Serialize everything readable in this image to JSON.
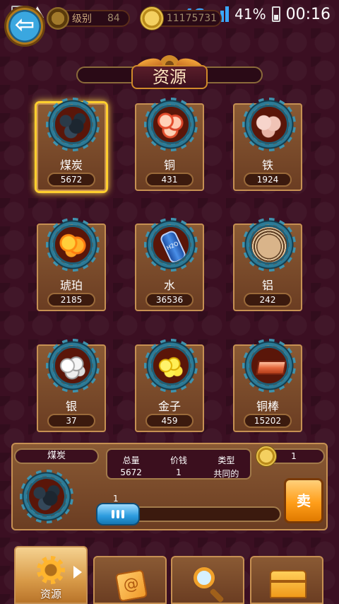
{
  "status_bar": {
    "network": "4G",
    "battery": "41%",
    "time": "00:16"
  },
  "header": {
    "level_label": "级别",
    "level_value": "84",
    "coins": "11175731",
    "title": "资源"
  },
  "resources": [
    {
      "name": "煤炭",
      "count": "5672",
      "art": "coal",
      "selected": true
    },
    {
      "name": "铜",
      "count": "431",
      "art": "copper"
    },
    {
      "name": "铁",
      "count": "1924",
      "art": "iron"
    },
    {
      "name": "琥珀",
      "count": "2185",
      "art": "amber"
    },
    {
      "name": "水",
      "count": "36536",
      "art": "water",
      "label": "H2O"
    },
    {
      "name": "铝",
      "count": "242",
      "art": "aluminum"
    },
    {
      "name": "银",
      "count": "37",
      "art": "silver"
    },
    {
      "name": "金子",
      "count": "459",
      "art": "gold"
    },
    {
      "name": "铜棒",
      "count": "15202",
      "art": "copperbar"
    }
  ],
  "detail": {
    "name": "煤炭",
    "total_label": "总量",
    "total_value": "5672",
    "price_label": "价钱",
    "price_value": "1",
    "type_label": "类型",
    "type_value": "共同的",
    "sell_price": "1",
    "quantity": "1",
    "sell_label": "卖"
  },
  "nav": {
    "resources_label": "资源"
  },
  "colors": {
    "background": "#3b0f22",
    "card": "#7a4a2a",
    "accent_orange": "#ff9e1a",
    "slider_blue": "#2b9bde",
    "selected_glow": "#ffcf2e"
  }
}
